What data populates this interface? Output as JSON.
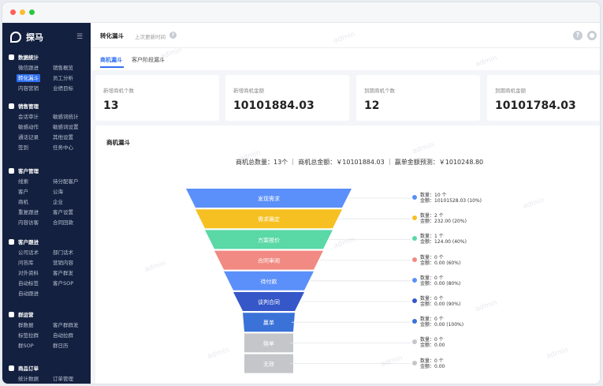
{
  "app": {
    "name": "探马",
    "colors": {
      "accent": "#2f6ff0",
      "sidebar": "#13203f"
    }
  },
  "sidebar": {
    "sections": [
      {
        "title": "数据统计",
        "icon": "chart-icon",
        "items": [
          "微信跟进",
          "销售概览",
          "转化漏斗",
          "员工分析",
          "内容营销",
          "业绩目标"
        ]
      },
      {
        "title": "销售管理",
        "icon": "user-icon",
        "items": [
          "会话审计",
          "敏感词统计",
          "敏感动作",
          "敏感词设置",
          "通话记录",
          "其他设置",
          "签到",
          "任务中心"
        ]
      },
      {
        "title": "客户管理",
        "icon": "customer-icon",
        "items": [
          "线索",
          "待分配客户",
          "客户",
          "公海",
          "商机",
          "企业",
          "重复跟进",
          "客户设置",
          "内容访客",
          "合同回款"
        ]
      },
      {
        "title": "客户跟进",
        "icon": "follow-icon",
        "items": [
          "公司话术",
          "部门话术",
          "问答库",
          "营销内容",
          "对外资料",
          "客户群发",
          "自动标签",
          "客户SOP",
          "自动跟进"
        ]
      },
      {
        "title": "群运营",
        "icon": "group-icon",
        "items": [
          "群数据",
          "客户群群发",
          "标签拉群",
          "自动拉群",
          "群SOP",
          "群日历"
        ]
      },
      {
        "title": "商品订单",
        "icon": "order-icon",
        "items": [
          "统计数据",
          "订单管理"
        ]
      }
    ],
    "active_item": "转化漏斗"
  },
  "header": {
    "title": "转化漏斗",
    "subtitle": "上次更新时间",
    "help_icon": "question-circle-icon",
    "avatar_icon": "user-avatar-icon"
  },
  "tabs": [
    "商机漏斗",
    "客户阶段漏斗"
  ],
  "active_tab": "商机漏斗",
  "stats": [
    {
      "label": "新增商机个数",
      "value": "13"
    },
    {
      "label": "新增商机金额",
      "value": "10101884.03"
    },
    {
      "label": "到期商机个数",
      "value": "12"
    },
    {
      "label": "到期商机金额",
      "value": "10101784.03"
    }
  ],
  "panel": {
    "title": "商机漏斗",
    "summary": "商机总数量：13个 ｜ 商机总金额：￥10101884.03 ｜ 赢单金额预测：￥1010248.80"
  },
  "funnel": [
    {
      "stage": "发现需求",
      "color": "#5b8ff9",
      "count": "数量：10 个",
      "amount": "金额：10101528.03  (10%)"
    },
    {
      "stage": "需求确定",
      "color": "#f6c022",
      "count": "数量：2 个",
      "amount": "金额：232.00  (20%)"
    },
    {
      "stage": "方案报价",
      "color": "#5ad8a6",
      "count": "数量：1 个",
      "amount": "金额：124.00  (40%)"
    },
    {
      "stage": "合同审阅",
      "color": "#f08a82",
      "count": "数量：0 个",
      "amount": "金额：0.00  (60%)"
    },
    {
      "stage": "待付款",
      "color": "#5b8ff9",
      "count": "数量：0 个",
      "amount": "金额：0.00  (80%)"
    },
    {
      "stage": "谈判合同",
      "color": "#3557c8",
      "count": "数量：0 个",
      "amount": "金额：0.00  (90%)"
    },
    {
      "stage": "赢单",
      "color": "#3a72d8",
      "count": "数量：0 个",
      "amount": "金额：0.00  (100%)"
    },
    {
      "stage": "输单",
      "color": "#c4c6ca",
      "count": "数量：0 个",
      "amount": "金额：0.00"
    },
    {
      "stage": "无效",
      "color": "#c4c6ca",
      "count": "数量：0 个",
      "amount": "金额：0.00"
    }
  ],
  "watermark": "admin"
}
